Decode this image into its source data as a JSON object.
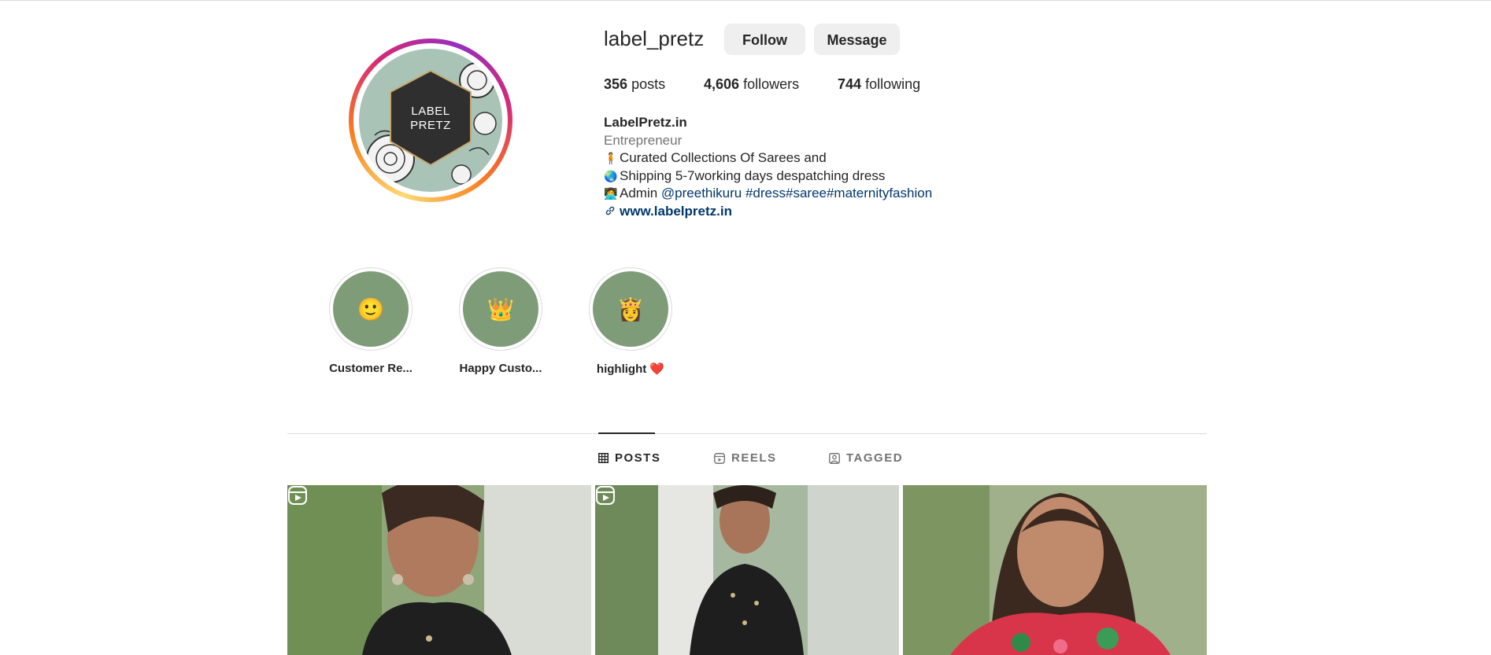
{
  "profile": {
    "username": "label_pretz",
    "follow_label": "Follow",
    "message_label": "Message",
    "avatar_text_line1": "LABEL",
    "avatar_text_line2": "PRETZ"
  },
  "stats": {
    "posts_count": "356",
    "posts_label": "posts",
    "followers_count": "4,606",
    "followers_label": "followers",
    "following_count": "744",
    "following_label": "following"
  },
  "bio": {
    "display_name": "LabelPretz.in",
    "category": "Entrepreneur",
    "line1_emoji": "🧍",
    "line1": "Curated Collections Of Sarees and",
    "line2_emoji": "🌏",
    "line2": "Shipping 5-7working days despatching dress",
    "line3_emoji": "👩‍💻",
    "line3_prefix": "Admin",
    "line3_mention": "@preethikuru",
    "line3_hashtags": "#dress#saree#maternityfashion",
    "website": "www.labelpretz.in"
  },
  "highlights": [
    {
      "label": "Customer Re...",
      "emoji": "🙂"
    },
    {
      "label": "Happy Custo...",
      "emoji": "👑"
    },
    {
      "label": "highlight ❤️",
      "emoji": "👸"
    }
  ],
  "tabs": {
    "posts": "POSTS",
    "reels": "REELS",
    "tagged": "TAGGED"
  },
  "icons": {
    "link": "link-icon",
    "grid": "grid-icon",
    "reels": "reels-icon",
    "tagged": "tagged-icon"
  },
  "colors": {
    "link": "#00376b",
    "highlight_bg": "#7f9c78",
    "avatar_bg": "#a9c4b6"
  }
}
